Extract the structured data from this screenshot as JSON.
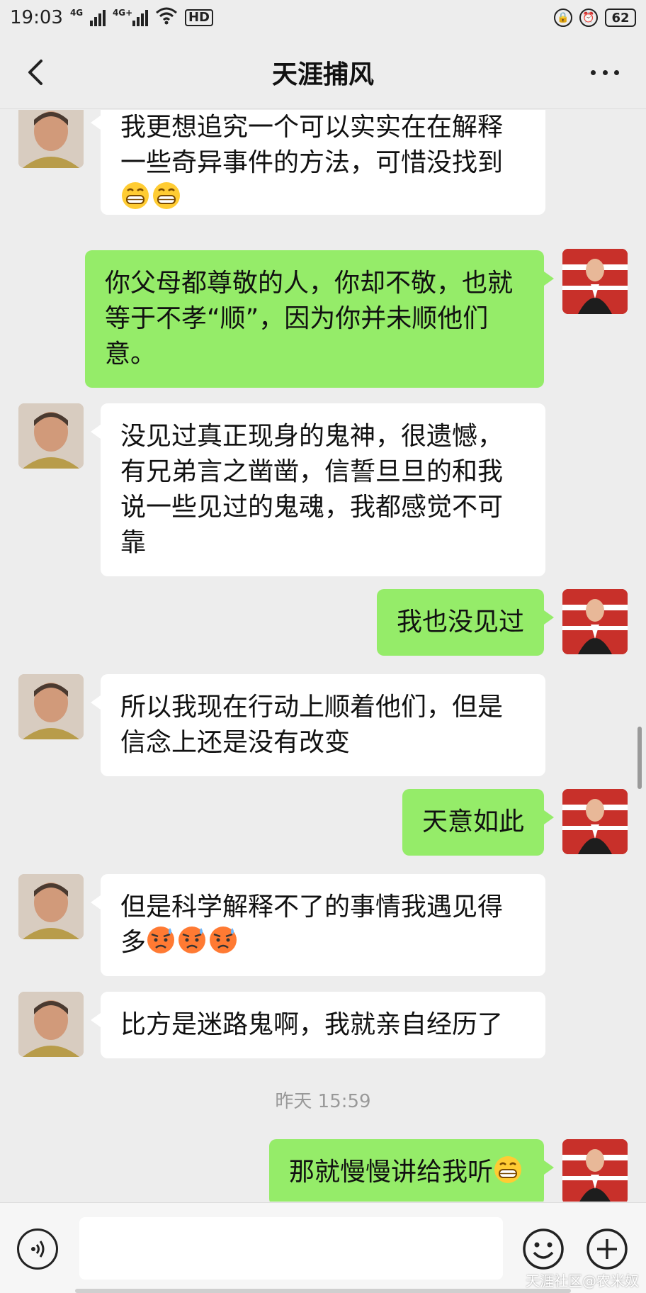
{
  "status_bar": {
    "time": "19:03",
    "net1": "4G",
    "net2": "4G+",
    "hd": "HD",
    "battery": "62"
  },
  "header": {
    "title": "天涯捕风"
  },
  "messages": [
    {
      "side": "in",
      "text": "我更想追究一个可以实实在在解释一些奇异事件的方法，可惜没找到",
      "emojis": [
        "grin",
        "grin"
      ]
    },
    {
      "side": "out",
      "text": "你父母都尊敬的人，你却不敬，也就等于不孝“顺”，因为你并未顺他们意。"
    },
    {
      "side": "in",
      "text": "没见过真正现身的鬼神，很遗憾，有兄弟言之凿凿，信誓旦旦的和我说一些见过的鬼魂，我都感觉不可靠"
    },
    {
      "side": "out",
      "text": "我也没见过"
    },
    {
      "side": "in",
      "text": "所以我现在行动上顺着他们，但是信念上还是没有改变"
    },
    {
      "side": "out",
      "text": "天意如此"
    },
    {
      "side": "in",
      "text": "但是科学解释不了的事情我遇见得多",
      "emojis": [
        "sweat",
        "sweat",
        "sweat"
      ]
    },
    {
      "side": "in",
      "text": "比方是迷路鬼啊，我就亲自经历了"
    },
    {
      "side": "out",
      "text": "那就慢慢讲给我听",
      "emojis": [
        "grin"
      ]
    }
  ],
  "timestamp": "昨天 15:59",
  "input": {
    "value": ""
  },
  "watermark": "天涯社区@农米奴",
  "icons": {
    "back": "chevron-left-icon",
    "more": "more-dots-icon",
    "voice": "voice-icon",
    "emoji": "emoji-smile-icon",
    "plus": "plus-icon"
  },
  "colors": {
    "self_bubble": "#95ec69",
    "friend_bubble": "#ffffff",
    "background": "#ededed"
  }
}
